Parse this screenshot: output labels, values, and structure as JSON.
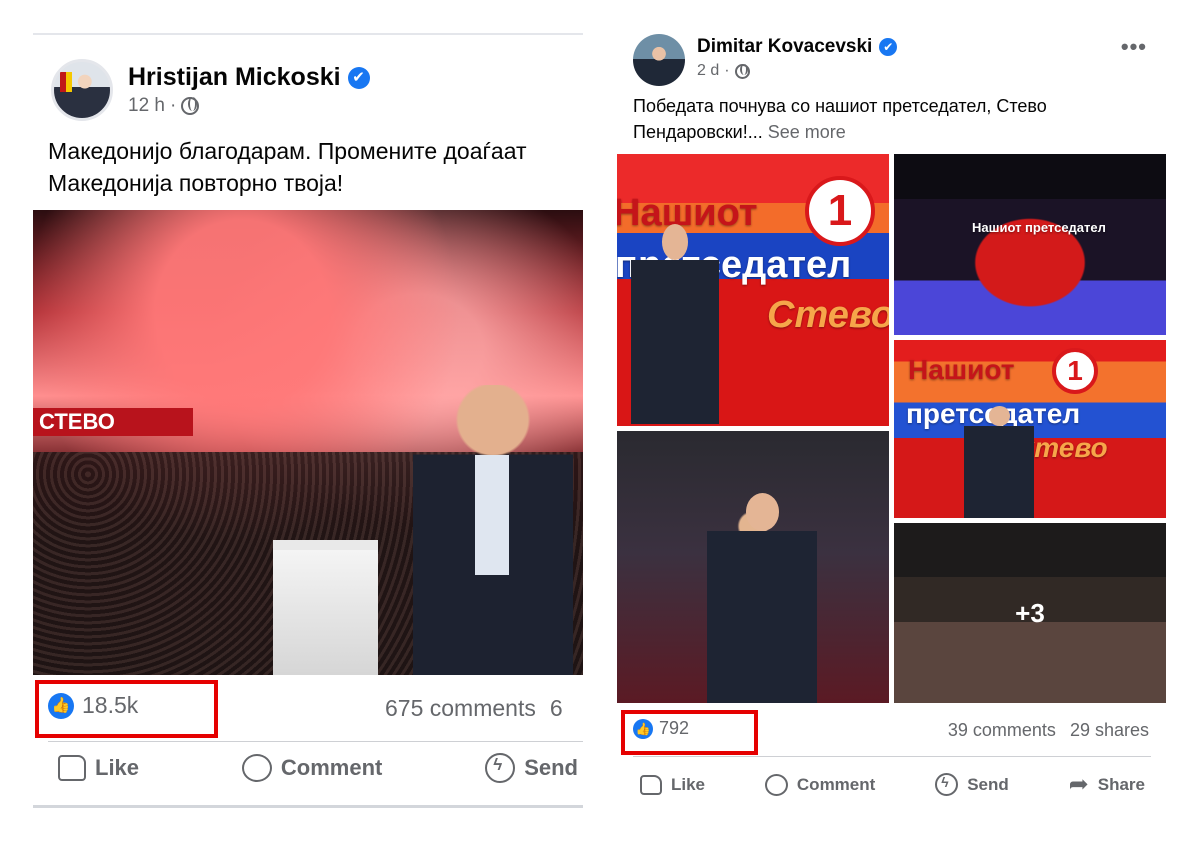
{
  "left_post": {
    "author": "Hristijan Mickoski",
    "verified_mark": "✔",
    "time": "12 h",
    "dot": "·",
    "text_line1": "Македонијо благодарам. Промените доаѓаат",
    "text_line2": "Македонија повторно твоја!",
    "photo_banner": "СТЕВО",
    "reaction_count": "18.5k",
    "comments": "675 comments",
    "shares_partial": "6",
    "actions": {
      "like": "Like",
      "comment": "Comment",
      "send": "Send"
    }
  },
  "right_post": {
    "author": "Dimitar Kovacevski",
    "verified_mark": "✔",
    "time": "2 d",
    "dot": "·",
    "more_dots": "•••",
    "text": "Победата почнува со нашиот претседател, Стево Пендаровски!...",
    "see_more": "See more",
    "tiles": {
      "a_line1": "Нашиот",
      "a_num": "1",
      "a_line2": "претседател",
      "a_line3": "Стево",
      "b_small": "Нашиот претседател",
      "c_line1": "Нашиот",
      "c_num": "1",
      "c_line2": "претседател",
      "c_line3": "Стево",
      "e_more": "+3"
    },
    "reaction_count": "792",
    "comments": "39 comments",
    "shares": "29 shares",
    "actions": {
      "like": "Like",
      "comment": "Comment",
      "send": "Send",
      "share": "Share"
    }
  },
  "colors": {
    "facebook_blue": "#1877f2",
    "highlight_red": "#e50000",
    "secondary_text": "#65676b"
  },
  "icons": [
    "verified-badge-icon",
    "globe-icon",
    "like-reaction-icon",
    "like-icon",
    "comment-icon",
    "messenger-send-icon",
    "share-icon",
    "more-options-icon"
  ]
}
